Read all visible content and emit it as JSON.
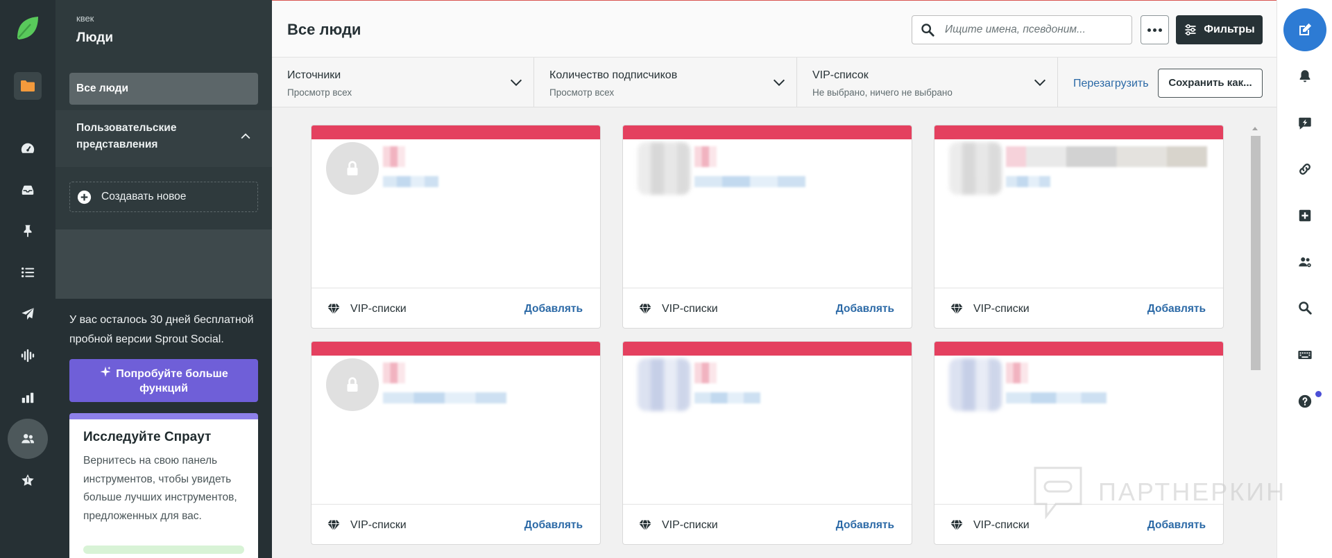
{
  "colors": {
    "brand_green": "#59c95b",
    "card_band": "#e4405f",
    "link": "#2b69a6",
    "upgrade": "#6f5fd8",
    "compose": "#2d7bd4",
    "folder": "#f39a3c",
    "notice_dot": "#4b4fd6"
  },
  "left_rail": {
    "items": [
      "sprout-logo",
      "folder-icon",
      "dashboard-icon",
      "inbox-icon",
      "pin-icon",
      "list-icon",
      "send-icon",
      "listening-icon",
      "reports-icon",
      "people-icon",
      "reviews-icon"
    ],
    "active": "people-icon"
  },
  "nav": {
    "workspace": "квек",
    "title": "Люди",
    "all_people": "Все люди",
    "custom_views": "Пользовательские представления",
    "create_new": "Создавать новое",
    "trial_text": "У вас осталось 30 дней бесплатной пробной версии Sprout Social.",
    "upgrade_button": "Попробуйте больше функций",
    "explore": {
      "title": "Исследуйте Спраут",
      "body": "Вернитесь на свою панель инструментов, чтобы увидеть больше лучших инструментов, предложенных для вас."
    }
  },
  "header": {
    "title": "Все люди",
    "search_placeholder": "Ищите имена, псевдоним...",
    "filters_label": "Фильтры"
  },
  "filters": [
    {
      "label": "Источники",
      "value": "Просмотр всех"
    },
    {
      "label": "Количество подписчиков",
      "value": "Просмотр всех"
    },
    {
      "label": "VIP-список",
      "value": "Не выбрано, ничего не выбрано"
    }
  ],
  "actions": {
    "reload": "Перезагрузить",
    "save_as": "Сохранить как..."
  },
  "cards": [
    {
      "avatar": "lock-icon",
      "list_label": "VIP-списки",
      "add_label": "Добавлять"
    },
    {
      "avatar": "blurred-photo",
      "list_label": "VIP-списки",
      "add_label": "Добавлять"
    },
    {
      "avatar": "blurred-photo",
      "list_label": "VIP-списки",
      "add_label": "Добавлять"
    },
    {
      "avatar": "lock-icon",
      "list_label": "VIP-списки",
      "add_label": "Добавлять"
    },
    {
      "avatar": "blurred-photo",
      "list_label": "VIP-списки",
      "add_label": "Добавлять"
    },
    {
      "avatar": "blurred-photo",
      "list_label": "VIP-списки",
      "add_label": "Добавлять"
    }
  ],
  "right_rail": {
    "items": [
      "compose-icon",
      "bell-icon",
      "quick-reply-icon",
      "link-icon",
      "plus-square-icon",
      "users-icon",
      "search-icon",
      "keyboard-icon",
      "help-icon"
    ]
  },
  "watermark": "ПАРТНЕРКИН"
}
